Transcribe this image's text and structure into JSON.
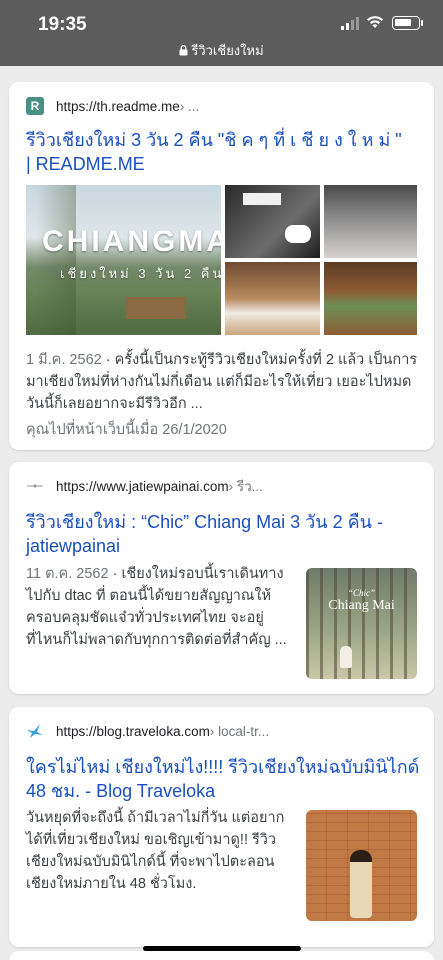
{
  "status_bar": {
    "time": "19:35",
    "url": "รีวิวเชียงใหม่"
  },
  "results": [
    {
      "favicon_letter": "R",
      "domain": "https://th.readme.me",
      "path": " › ...",
      "title": "รีวิวเชียงใหม่ 3 วัน 2 คืน \"ชิ ค ๆ ที่ เ ชี ย ง ใ ห ม่ \" | README.ME",
      "image_text_main": "CHIANGMA",
      "image_text_sub": "เชียงใหม่ 3 วัน 2 คืน",
      "date": "1 มี.ค. 2562",
      "snippet": "ครั้งนี้เป็นกระทู้รีวิวเชียงใหม่ครั้งที่ 2 แล้ว เป็นการมาเชียงใหม่ที่ห่างกันไม่กี่เดือน แต่ก็มีอะไรให้เที่ยว เยอะไปหมด วันนี้ก็เลยอยากจะมีรีวิวอีก ...",
      "visited": "คุณไปที่หน้าเว็บนี้เมื่อ 26/1/2020"
    },
    {
      "domain": "https://www.jatiewpainai.com",
      "path": " › รีว...",
      "title": "รีวิวเชียงใหม่ : “Chic” Chiang Mai 3 วัน 2 คืน - jatiewpainai",
      "date": "11 ต.ค. 2562",
      "snippet": "เชียงใหม่รอบนี้เราเดินทางไปกับ dtac ที่ ตอนนี้ได้ขยายสัญญาณให้ครอบคลุมชัดแจ๋วทั่วประเทศไทย จะอยู่ที่ไหนก็ไม่พลาดกับทุกการติดต่อที่สำคัญ ...",
      "thumb_text_1": "“Chic”",
      "thumb_text_2": "Chiang Mai"
    },
    {
      "domain": "https://blog.traveloka.com",
      "path": " › local-tr...",
      "title": "ใครไม่ไหม่ เชียงใหม่ไง!!!! รีวิวเชียงใหม่ฉบับมินิไกด์ 48 ชม. - Blog Traveloka",
      "snippet": "วันหยุดที่จะถึงนี้ ถ้ามีเวลาไม่กี่วัน แต่อยากได้ที่เที่ยวเชียงใหม่ ขอเชิญเข้ามาดู!! รีวิวเชียงใหม่ฉบับมินิไกด์นี้ ที่จะพาไปตะลอนเชียงใหม่ภายใน 48 ชั่วโมง."
    }
  ],
  "colors": {
    "link": "#1a4fbf",
    "status_bar": "#5c5c5c",
    "page_bg": "#ececec"
  }
}
